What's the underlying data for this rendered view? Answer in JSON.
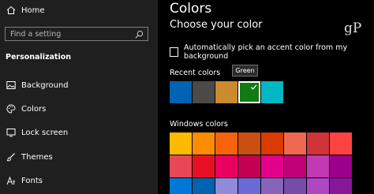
{
  "sidebar": {
    "home_label": "Home",
    "search_placeholder": "Find a setting",
    "section_label": "Personalization",
    "items": [
      {
        "label": "Background",
        "icon": "picture-icon"
      },
      {
        "label": "Colors",
        "icon": "palette-icon"
      },
      {
        "label": "Lock screen",
        "icon": "lock-screen-icon"
      },
      {
        "label": "Themes",
        "icon": "brush-icon"
      },
      {
        "label": "Fonts",
        "icon": "font-icon"
      }
    ]
  },
  "main": {
    "title": "Colors",
    "subtitle": "Choose your color",
    "watermark": "gP",
    "auto_accent_label": "Automatically pick an accent color from my background",
    "auto_accent_checked": false,
    "recent_label": "Recent colors",
    "tooltip": "Green",
    "recent_colors": [
      "#0063b1",
      "#4c4a48",
      "#ca8a2e",
      "#107c10",
      "#00b7c3"
    ],
    "selected_recent": 3,
    "windows_label": "Windows colors",
    "windows_colors": [
      [
        "#ffb900",
        "#ff8c00",
        "#f7630c",
        "#ca5010",
        "#da3b01",
        "#ef6950",
        "#d13438",
        "#ff4343"
      ],
      [
        "#e74856",
        "#e81123",
        "#ea005e",
        "#c30052",
        "#e3008c",
        "#bf0077",
        "#c239b3",
        "#9a0089"
      ],
      [
        "#0078d7",
        "#0063b1",
        "#8e8cd8",
        "#6b69d6",
        "#8764b8",
        "#744da9",
        "#b146c2",
        "#881798"
      ]
    ]
  }
}
